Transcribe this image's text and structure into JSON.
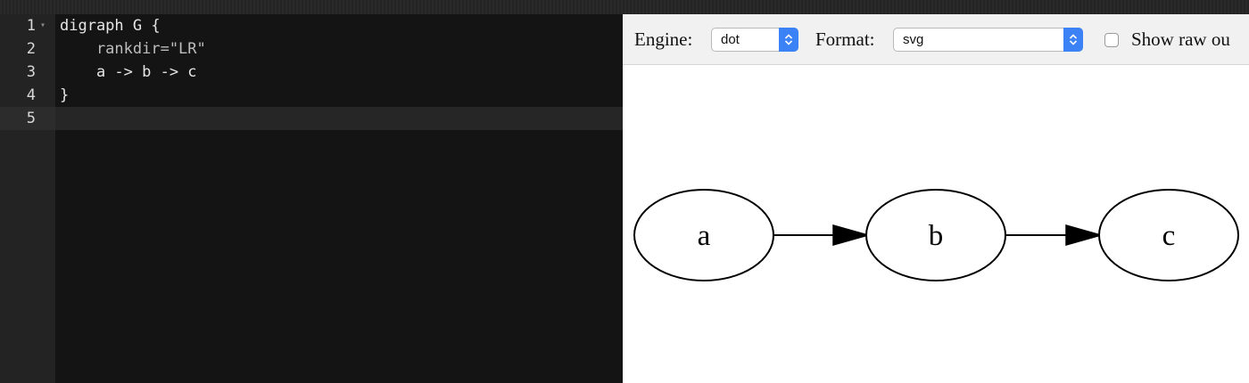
{
  "editor": {
    "lines": [
      {
        "number": "1",
        "text": "digraph G {"
      },
      {
        "number": "2",
        "text": "    rankdir=\"LR\""
      },
      {
        "number": "3",
        "text": "    a -> b -> c"
      },
      {
        "number": "4",
        "text": "}"
      },
      {
        "number": "5",
        "text": ""
      }
    ]
  },
  "toolbar": {
    "engine_label": "Engine:",
    "engine_value": "dot",
    "format_label": "Format:",
    "format_value": "svg",
    "raw_output_label": "Show raw ou"
  },
  "graph": {
    "nodes": [
      "a",
      "b",
      "c"
    ],
    "edges": [
      [
        "a",
        "b"
      ],
      [
        "b",
        "c"
      ]
    ]
  },
  "icons": {
    "fold": "chevron-down-icon",
    "select_arrow": "updown-arrows-icon"
  },
  "colors": {
    "select_accent": "#3b82f6",
    "editor_bg": "#141414",
    "gutter_bg": "#232323"
  }
}
